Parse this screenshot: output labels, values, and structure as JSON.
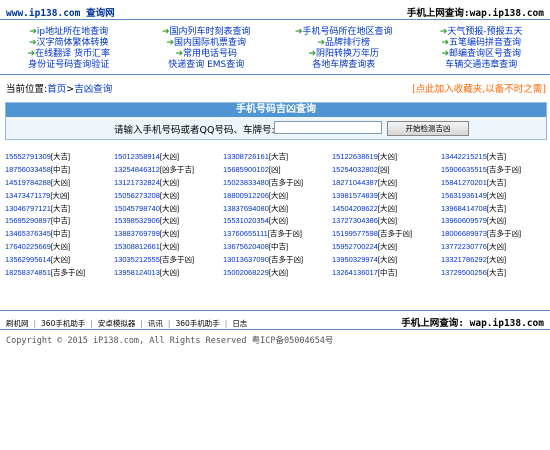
{
  "header": {
    "site_title": "www.ip138.com 查询网",
    "mobile_access": "手机上网查询:wap.ip138.com"
  },
  "nav": {
    "rows": [
      [
        "ip地址所在地查询",
        "国内列车时刻表查询",
        "手机号码所在地区查询",
        "天气预报-预报五天"
      ],
      [
        "汉字简体繁体转换",
        "国内国际机票查询",
        "品牌排行榜",
        "五笔编码拼音查询"
      ],
      [
        "在线翻译 货币汇率",
        "常用电话号码",
        "阴阳转换万年历",
        "邮编查询区号查询"
      ],
      [
        "身份证号码查询验证",
        "快递查询 EMS查询",
        "各地车牌查询表",
        "车辆交通违章查询"
      ]
    ],
    "arrows": [
      [
        true,
        true,
        true,
        true
      ],
      [
        true,
        true,
        true,
        true
      ],
      [
        true,
        true,
        true,
        true
      ],
      [
        false,
        false,
        false,
        false
      ]
    ]
  },
  "breadcrumb": {
    "prefix": "当前位置:",
    "home": "首页",
    "separator": ">",
    "current": "吉凶查询"
  },
  "favorite_text": "[点此加入收藏夹,以备不时之需]",
  "query_panel": {
    "title": "手机号码吉凶查询",
    "label": "请输入手机号码或者QQ号码、车牌号:",
    "input_value": "",
    "button_label": "开始检测吉凶"
  },
  "results": [
    [
      [
        "15552791309",
        "[大吉]"
      ],
      [
        "15012358914",
        "[大凶]"
      ],
      [
        "13308726161",
        "[大吉]"
      ],
      [
        "15122638619",
        "[大凶]"
      ],
      [
        "13442215215",
        "[大吉]"
      ]
    ],
    [
      [
        "18756033458",
        "[中吉]"
      ],
      [
        "13254846312",
        "[凶多于吉]"
      ],
      [
        "15685900102",
        "[凶]"
      ],
      [
        "15254032802",
        "[凶]"
      ],
      [
        "15906635515",
        "[吉多于凶]"
      ]
    ],
    [
      [
        "14519784288",
        "[大凶]"
      ],
      [
        "13121732824",
        "[大凶]"
      ],
      [
        "15023833480",
        "[吉多于凶]"
      ],
      [
        "18271044387",
        "[大凶]"
      ],
      [
        "15841270201",
        "[大吉]"
      ]
    ],
    [
      [
        "13473471179",
        "[大凶]"
      ],
      [
        "15056273208",
        "[大凶]"
      ],
      [
        "18800912206",
        "[大凶]"
      ],
      [
        "13981574839",
        "[大凶]"
      ],
      [
        "15631936149",
        "[大凶]"
      ]
    ],
    [
      [
        "13046797121",
        "[大吉]"
      ],
      [
        "15045798740",
        "[大凶]"
      ],
      [
        "13837694080",
        "[大凶]"
      ],
      [
        "14504208622",
        "[大凶]"
      ],
      [
        "13968414708",
        "[大吉]"
      ]
    ],
    [
      [
        "15695290897",
        "[中吉]"
      ],
      [
        "15398532906",
        "[大凶]"
      ],
      [
        "15531020354",
        "[大凶]"
      ],
      [
        "13727304386",
        "[大凶]"
      ],
      [
        "13960609579",
        "[大凶]"
      ]
    ],
    [
      [
        "13465376345",
        "[中吉]"
      ],
      [
        "13883769799",
        "[大凶]"
      ],
      [
        "13760655111",
        "[吉多于凶]"
      ],
      [
        "15199577598",
        "[吉多于凶]"
      ],
      [
        "18006689973",
        "[吉多于凶]"
      ]
    ],
    [
      [
        "17640225669",
        "[大凶]"
      ],
      [
        "15308812661",
        "[大凶]"
      ],
      [
        "13675620408",
        "[中吉]"
      ],
      [
        "15952700224",
        "[大凶]"
      ],
      [
        "13772230776",
        "[大凶]"
      ]
    ],
    [
      [
        "13562995614",
        "[大凶]"
      ],
      [
        "13035212555",
        "[吉多于凶]"
      ],
      [
        "13013637090",
        "[吉多于凶]"
      ],
      [
        "13950329974",
        "[大凶]"
      ],
      [
        "13321786292",
        "[大凶]"
      ]
    ],
    [
      [
        "18258374851",
        "[吉多于凶]"
      ],
      [
        "13958124013",
        "[大凶]"
      ],
      [
        "15002068229",
        "[大凶]"
      ],
      [
        "13264136017",
        "[中吉]"
      ],
      [
        "13729500256",
        "[大吉]"
      ]
    ]
  ],
  "footer": {
    "links": [
      "刷机网",
      "360手机助手",
      "安卓模拟器",
      "讯讯",
      "360手机助手",
      "日志"
    ],
    "separator": "|",
    "mobile_access": "手机上网查询: wap.ip138.com",
    "copyright": "Copyright © 2015 iP138.com, All Rights Reserved 粤ICP备05004654号"
  },
  "colors": {
    "link": "#0033cc",
    "panel_header": "#4f95d3",
    "favorite": "#ff6600",
    "arrow": "#2a9a2a"
  }
}
